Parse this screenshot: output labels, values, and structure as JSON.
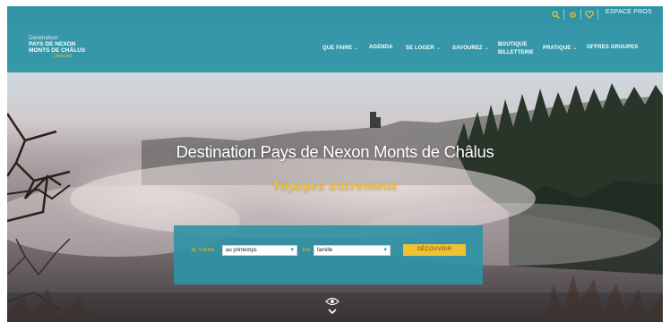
{
  "topbar": {
    "icons": [
      "search-icon",
      "gear-icon",
      "heart-icon"
    ],
    "espace_label": "ESPACE PROS"
  },
  "logo": {
    "line1": "Destination",
    "line2": "PAYS DE NEXON",
    "line3": "MONTS DE CHÂLUS",
    "tagline": "Limousin"
  },
  "nav": {
    "items": [
      {
        "label": "QUE FAIRE",
        "dropdown": true
      },
      {
        "label": "AGENDA",
        "dropdown": false
      },
      {
        "label": "SE LOGER",
        "dropdown": true
      },
      {
        "label": "SAVOUREZ",
        "dropdown": true
      },
      {
        "label": "BOUTIQUE",
        "label2": "BILLETTERIE",
        "dropdown": false
      },
      {
        "label": "PRATIQUE",
        "dropdown": true
      },
      {
        "label": "OFFRES GROUPES",
        "dropdown": false
      }
    ]
  },
  "hero": {
    "title": "Destination Pays de Nexon Monts de Châlus",
    "subtitle": "Voyagez autrement"
  },
  "search": {
    "label_when": "JE VIENS",
    "when_value": "au printemps",
    "label_with": "EN",
    "with_value": "famille",
    "button": "DÉCOUVRIR"
  },
  "colors": {
    "teal": "#2c93a6",
    "yellow": "#f0c233"
  }
}
